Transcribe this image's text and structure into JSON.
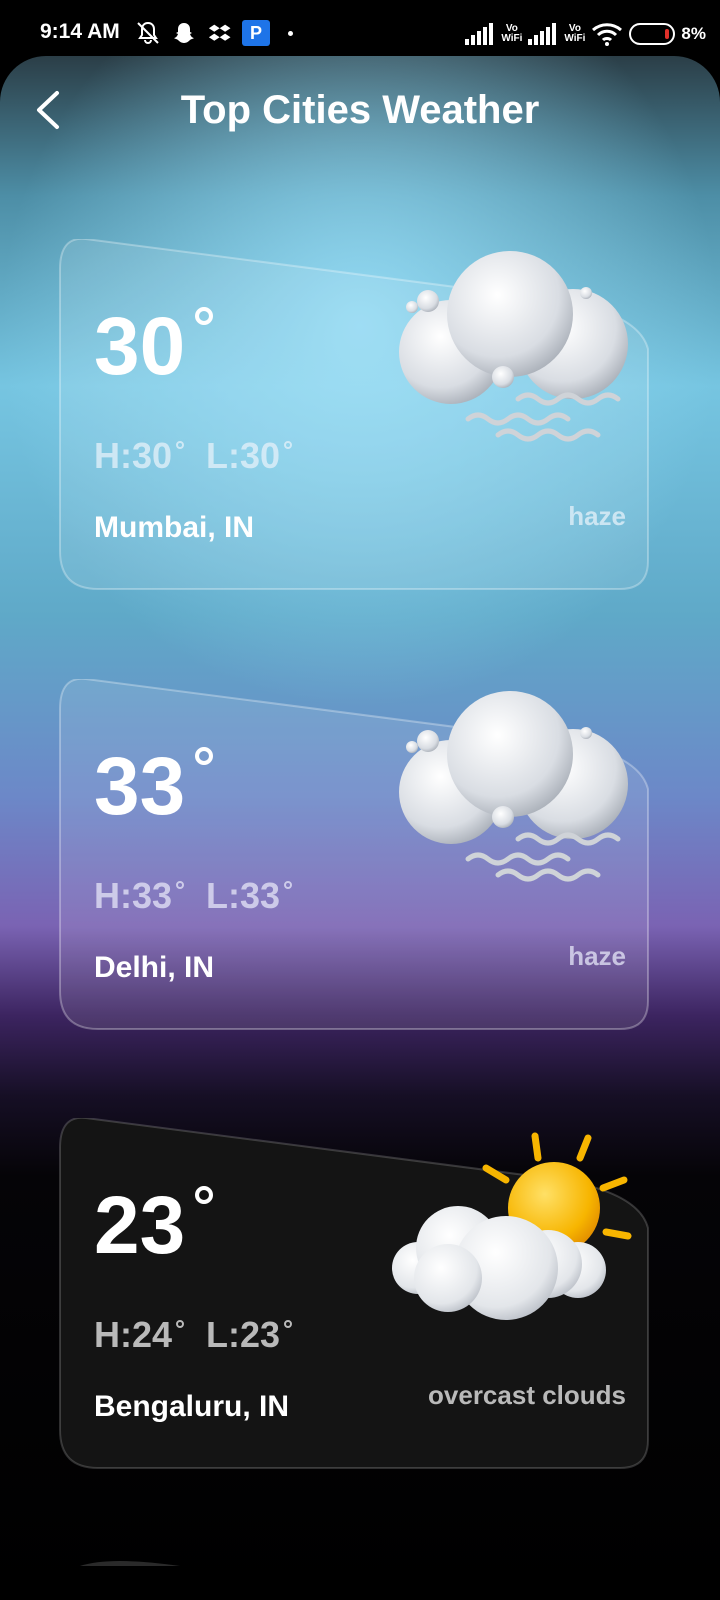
{
  "status_bar": {
    "time": "9:14 AM",
    "icons": [
      "notifications-off-icon",
      "snapchat-icon",
      "dropbox-icon",
      "paytm-icon",
      "dot-icon",
      "signal-icon",
      "vowifi-icon",
      "wifi-icon",
      "battery-icon"
    ],
    "vo_wifi_label_1": "Vo",
    "vo_wifi_label_2": "WiFi",
    "paytm_letter": "P",
    "battery_percent": "8%",
    "battery_color": "#e0302a"
  },
  "header": {
    "title": "Top Cities Weather",
    "back_icon": "chevron-left-icon"
  },
  "cards": [
    {
      "temp": "30",
      "high": "H:30",
      "low": "L:30",
      "city": "Mumbai, IN",
      "description": "haze",
      "icon": "haze-cloud-icon"
    },
    {
      "temp": "33",
      "high": "H:33",
      "low": "L:33",
      "city": "Delhi, IN",
      "description": "haze",
      "icon": "haze-cloud-icon"
    },
    {
      "temp": "23",
      "high": "H:24",
      "low": "L:23",
      "city": "Bengaluru, IN",
      "description": "overcast clouds",
      "icon": "sun-cloud-icon"
    }
  ],
  "colors": {
    "sky_light": "#76c5e1",
    "violet": "#7a63b3",
    "card_dark": "#141414",
    "sun": "#f7b500"
  }
}
